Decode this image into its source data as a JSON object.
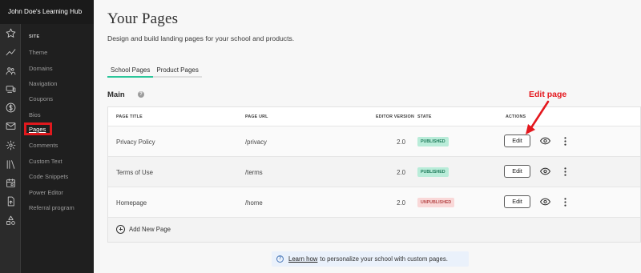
{
  "sidebar": {
    "school_name": "John Doe's Learning Hub",
    "section": "SITE",
    "items": [
      {
        "label": "Theme",
        "active": false
      },
      {
        "label": "Domains",
        "active": false
      },
      {
        "label": "Navigation",
        "active": false
      },
      {
        "label": "Coupons",
        "active": false
      },
      {
        "label": "Bios",
        "active": false
      },
      {
        "label": "Pages",
        "active": true
      },
      {
        "label": "Comments",
        "active": false
      },
      {
        "label": "Custom Text",
        "active": false
      },
      {
        "label": "Code Snippets",
        "active": false
      },
      {
        "label": "Power Editor",
        "active": false
      },
      {
        "label": "Referral program",
        "active": false
      }
    ],
    "rail_icons": [
      "star-icon",
      "trend-icon",
      "users-icon",
      "devices-icon",
      "dollar-icon",
      "mail-icon",
      "gear-icon",
      "library-icon",
      "calendar-icon",
      "upload-icon",
      "shapes-icon"
    ]
  },
  "main": {
    "title": "Your Pages",
    "subtitle": "Design and build landing pages for your school and products.",
    "tabs": [
      {
        "label": "School Pages",
        "active": true
      },
      {
        "label": "Product Pages",
        "active": false
      }
    ],
    "section_title": "Main",
    "table": {
      "headers": {
        "title": "PAGE TITLE",
        "url": "PAGE URL",
        "version": "EDITOR VERSION",
        "state": "STATE",
        "actions": "ACTIONS"
      },
      "rows": [
        {
          "title": "Privacy Policy",
          "url": "/privacy",
          "version": "2.0",
          "state": "PUBLISHED",
          "edit": "Edit"
        },
        {
          "title": "Terms of Use",
          "url": "/terms",
          "version": "2.0",
          "state": "PUBLISHED",
          "edit": "Edit"
        },
        {
          "title": "Homepage",
          "url": "/home",
          "version": "2.0",
          "state": "UNPUBLISHED",
          "edit": "Edit"
        }
      ],
      "add_label": "Add New Page"
    },
    "learn": {
      "link": "Learn how",
      "text": "to personalize your school with custom pages."
    }
  },
  "annotation": {
    "label": "Edit page",
    "color": "#e4181e"
  },
  "colors": {
    "accent": "#2bc69a",
    "published_bg": "#b9ecd9",
    "unpublished_bg": "#f9d8d8",
    "sidebar_bg": "#1f1f1f"
  }
}
